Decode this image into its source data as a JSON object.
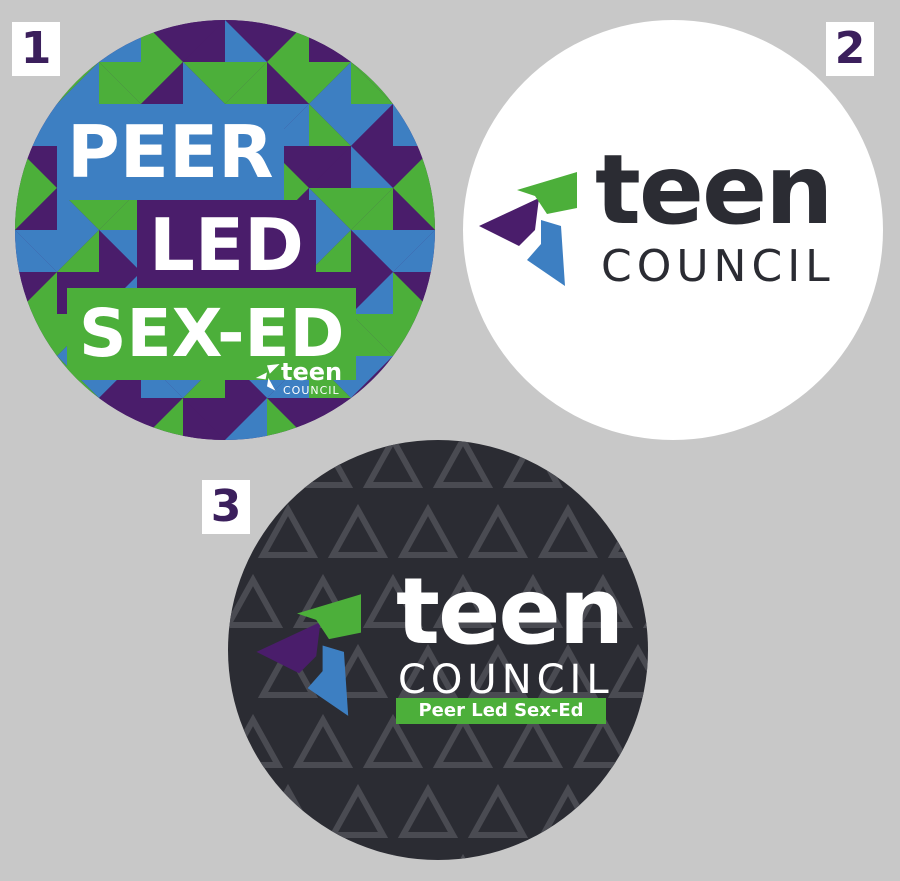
{
  "labels": {
    "one": "1",
    "two": "2",
    "three": "3"
  },
  "sticker1": {
    "lines": [
      "PEER",
      "LED",
      "SEX-ED"
    ],
    "mini_logo": {
      "teen": "teen",
      "council": "COUNCIL"
    }
  },
  "sticker2": {
    "teen": "teen",
    "council": "COUNCIL"
  },
  "sticker3": {
    "teen": "teen",
    "council": "COUNCIL",
    "tagline": "Peer Led Sex-Ed"
  },
  "colors": {
    "background": "#c8c8c8",
    "purple": "#4a1d6b",
    "green": "#4caf3a",
    "blue": "#3d7fc2",
    "dark": "#2b2c33",
    "white": "#ffffff"
  },
  "icons": [
    "triangle-swirl-logo-icon"
  ]
}
